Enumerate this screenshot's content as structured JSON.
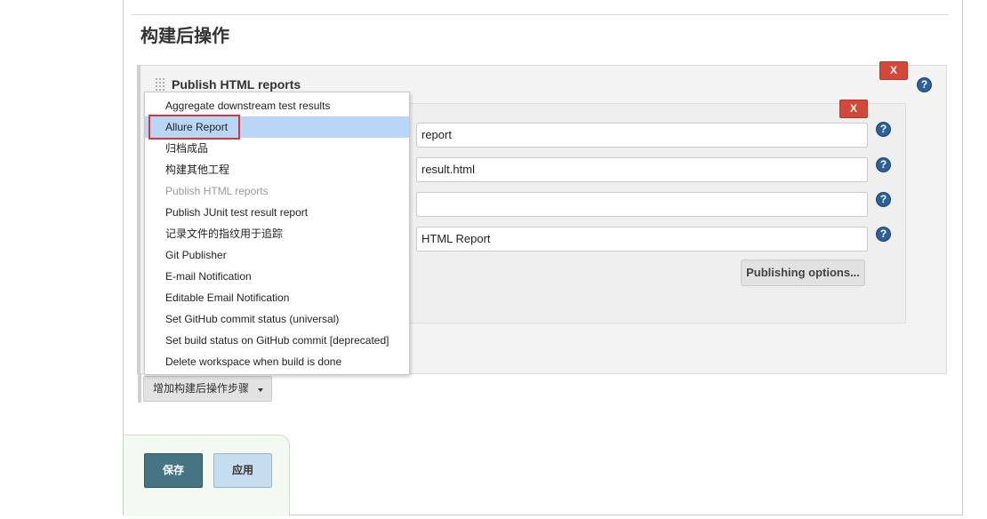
{
  "section_title": "构建后操作",
  "step": {
    "title": "Publish HTML reports",
    "delete_label": "X",
    "help_label": "?"
  },
  "inner": {
    "delete_label": "X",
    "fields": [
      {
        "value": "report"
      },
      {
        "value": "result.html"
      },
      {
        "value": ""
      },
      {
        "value": "HTML Report"
      }
    ],
    "publishing_options_label": "Publishing options..."
  },
  "add_step_label": "增加构建后操作步骤",
  "menu": {
    "items": [
      {
        "label": "Aggregate downstream test results",
        "state": "normal"
      },
      {
        "label": "Allure Report",
        "state": "selected"
      },
      {
        "label": "归档成品",
        "state": "normal"
      },
      {
        "label": "构建其他工程",
        "state": "normal"
      },
      {
        "label": "Publish HTML reports",
        "state": "disabled"
      },
      {
        "label": "Publish JUnit test result report",
        "state": "normal"
      },
      {
        "label": "记录文件的指纹用于追踪",
        "state": "normal"
      },
      {
        "label": "Git Publisher",
        "state": "normal"
      },
      {
        "label": "E-mail Notification",
        "state": "normal"
      },
      {
        "label": "Editable Email Notification",
        "state": "normal"
      },
      {
        "label": "Set GitHub commit status (universal)",
        "state": "normal"
      },
      {
        "label": "Set build status on GitHub commit [deprecated]",
        "state": "normal"
      },
      {
        "label": "Delete workspace when build is done",
        "state": "normal"
      }
    ]
  },
  "buttons": {
    "save_label": "保存",
    "apply_label": "应用"
  },
  "colors": {
    "delete": "#d24939",
    "help": "#2d5f9a",
    "selected_item": "#b9d6f7",
    "highlight": "#e0323b",
    "save": "#457483",
    "apply": "#c6dcef"
  }
}
